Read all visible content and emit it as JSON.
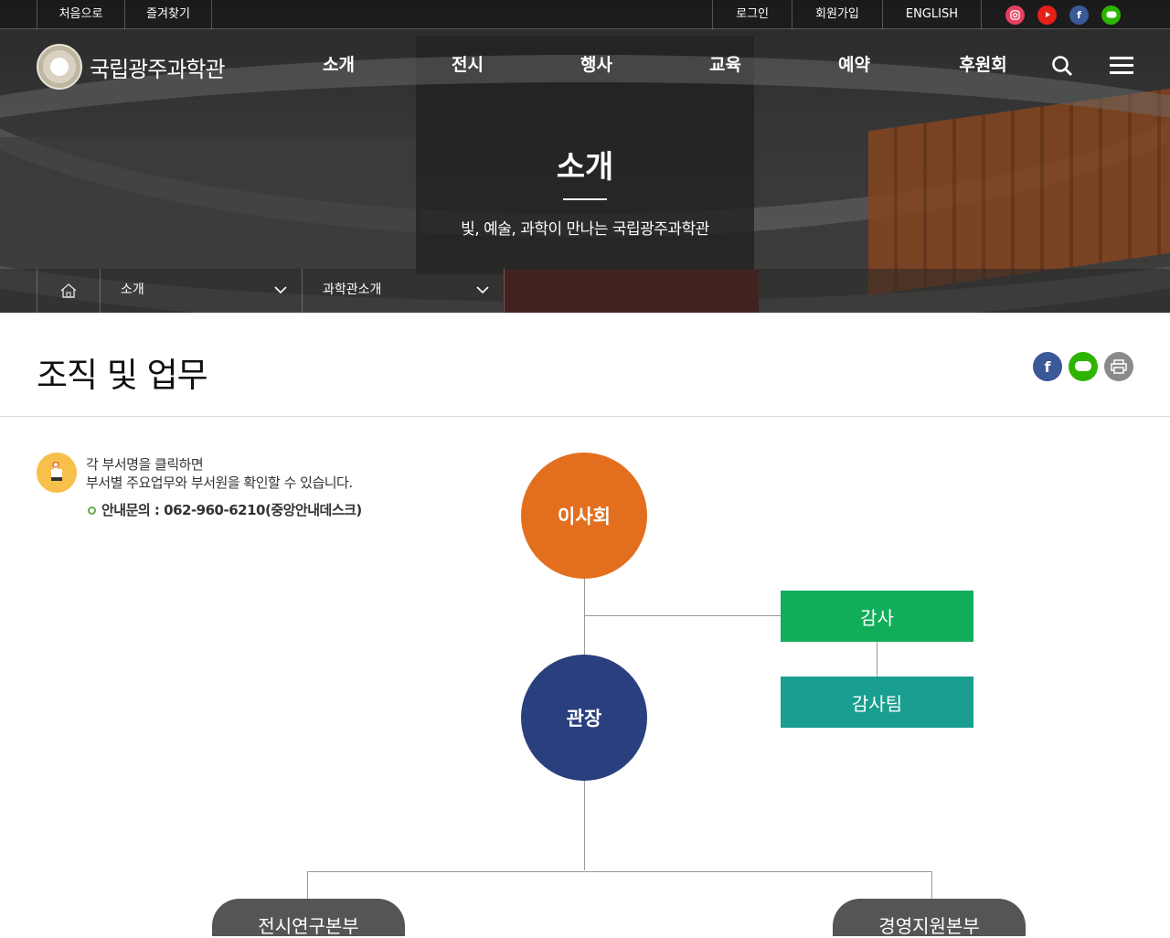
{
  "topbar": {
    "left_links": [
      "처음으로",
      "즐겨찾기"
    ],
    "right_links": [
      "로그인",
      "회원가입",
      "ENGLISH"
    ],
    "social": [
      {
        "icon": "instagram-icon",
        "color": "#e4405f"
      },
      {
        "icon": "youtube-icon",
        "color": "#e62117"
      },
      {
        "icon": "facebook-icon",
        "color": "#3b5998"
      },
      {
        "icon": "blog-icon",
        "color": "#2db400"
      }
    ]
  },
  "header": {
    "logo_text": "국립광주과학관",
    "menu": [
      "소개",
      "전시",
      "행사",
      "교육",
      "예약",
      "후원회"
    ]
  },
  "hero": {
    "title": "소개",
    "subtitle": "빛, 예술, 과학이 만나는 국립광주과학관"
  },
  "location": {
    "depth1": "소개",
    "depth2": "과학관소개"
  },
  "page": {
    "title": "조직 및 업무"
  },
  "guide": {
    "line1": "각 부서명을 클릭하면",
    "line2": "부서별 주요업무와 부서원을 확인할 수 있습니다.",
    "contact": "안내문의 : 062-960-6210(중앙안내데스크)"
  },
  "org": {
    "board": "이사회",
    "audit": "감사",
    "audit_team": "감사팀",
    "director": "관장",
    "division1": "전시연구본부",
    "division2": "경영지원본부"
  },
  "colors": {
    "board": "#e36f1e",
    "audit": "#12ad5b",
    "audit_team": "#1a9e90",
    "director": "#293f7e",
    "division": "#555555"
  }
}
